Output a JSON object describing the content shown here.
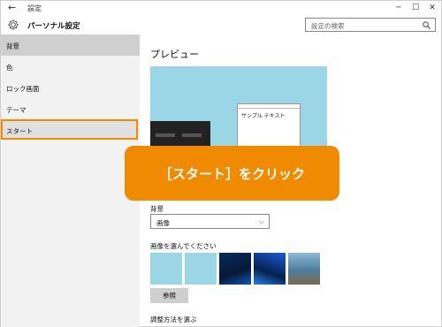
{
  "window": {
    "title": "設定",
    "back_glyph": "←",
    "controls": {
      "minimize": "─",
      "maximize": "☐",
      "close": "✕"
    }
  },
  "header": {
    "title": "パーソナル設定",
    "search_placeholder": "設定の検索"
  },
  "sidebar": {
    "items": [
      {
        "label": "背景"
      },
      {
        "label": "色"
      },
      {
        "label": "ロック画面"
      },
      {
        "label": "テーマ"
      },
      {
        "label": "スタート"
      }
    ],
    "highlighted": "スタート"
  },
  "main": {
    "title": "プレビュー",
    "sample_text": "サンプル テキスト",
    "background_label": "背景",
    "background_value": "画像",
    "choose_picture_label": "画像を選んでください",
    "browse_button": "参照",
    "fit_label": "調整方法を選ぶ"
  },
  "callout": {
    "text": "［スタート］をクリック",
    "color": "#f08a00"
  },
  "colors": {
    "accent": "#f08a00",
    "preview_bg": "#9bd6e7",
    "sidebar_bg": "#f2f2f2"
  }
}
